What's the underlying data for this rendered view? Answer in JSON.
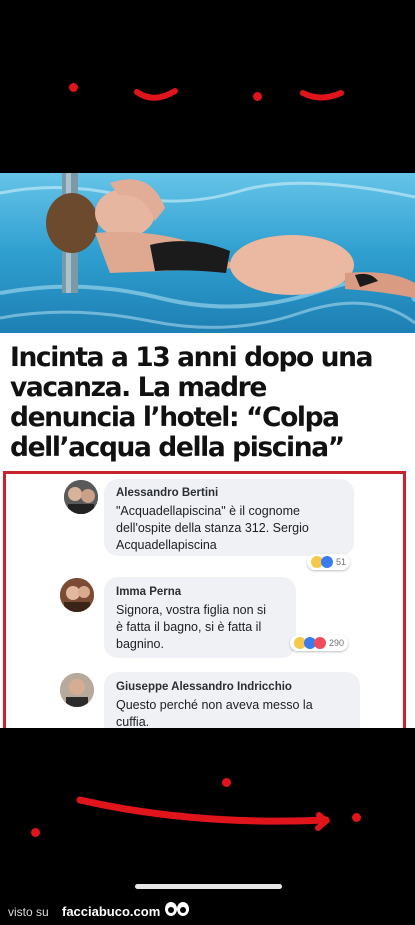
{
  "headline": {
    "line1": "Incinta a 13 anni dopo una",
    "line2": "vacanza. La madre",
    "line3": "denuncia l’hotel: “Colpa",
    "line4": "dell’acqua della piscina”"
  },
  "comments": [
    {
      "name": "Alessandro Bertini",
      "lines": [
        "\"Acquadellapiscina\" è il cognome",
        "dell'ospite della stanza 312. Sergio",
        "Acquadellapiscina"
      ],
      "reaction_count": "51"
    },
    {
      "name": "Imma Perna",
      "lines": [
        "Signora, vostra figlia non si",
        "è fatta il bagno, si è fatta il",
        "bagnino."
      ],
      "reaction_count": "290"
    },
    {
      "name": "Giuseppe Alessandro Indricchio",
      "lines": [
        "Questo perché non aveva messo la",
        "cuffia."
      ]
    }
  ],
  "footer": {
    "prefix": "visto su",
    "site": "facciabuco.com",
    "logo_icon": "eyes-logo-icon"
  },
  "colors": {
    "accent_red": "#e0141b",
    "frame_red": "#c8232c"
  }
}
